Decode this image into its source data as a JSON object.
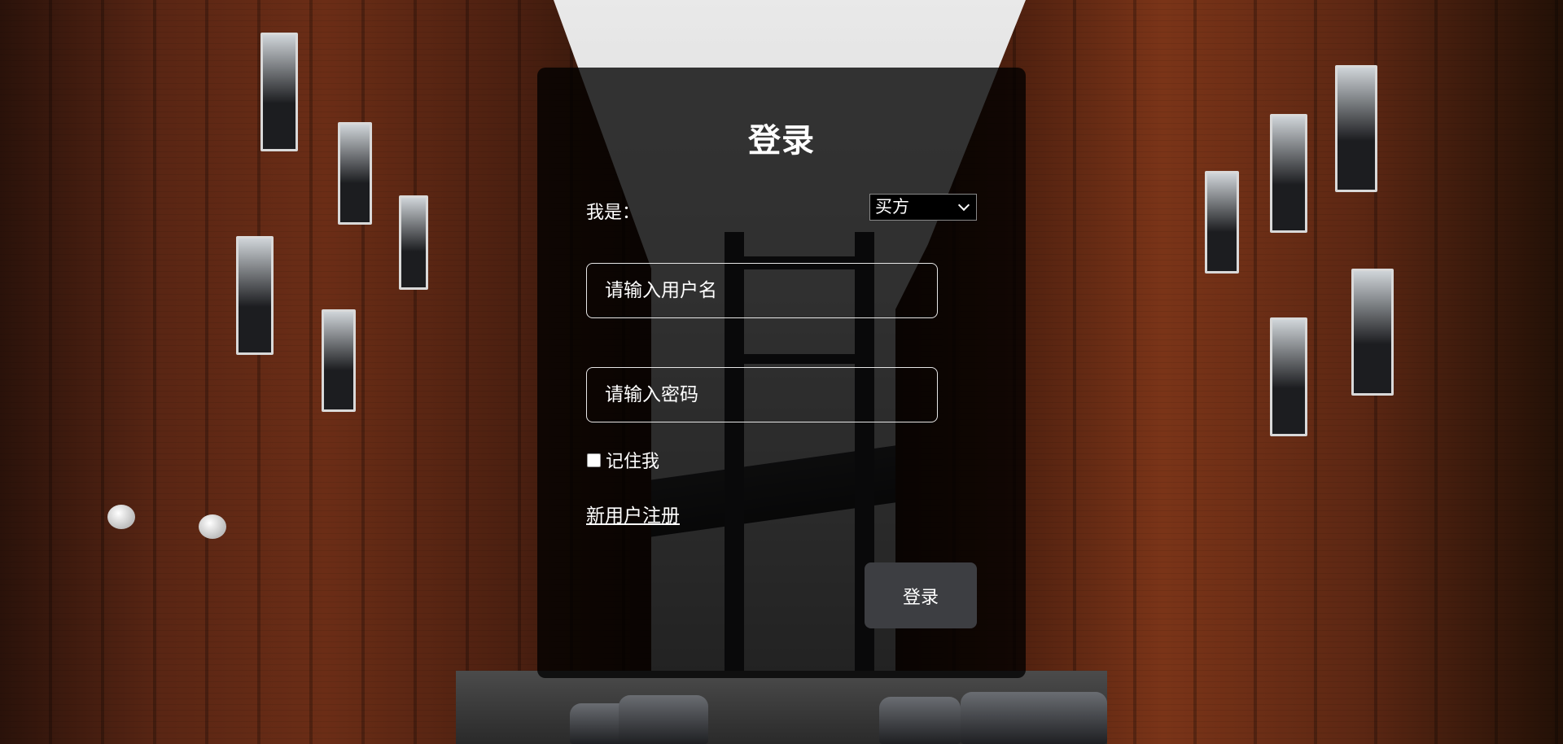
{
  "login": {
    "title": "登录",
    "role_label": "我是：",
    "role_selected": "买方",
    "username_placeholder": "请输入用户名",
    "password_placeholder": "请输入密码",
    "remember_label": "记住我",
    "register_link": "新用户注册",
    "submit_label": "登录"
  }
}
